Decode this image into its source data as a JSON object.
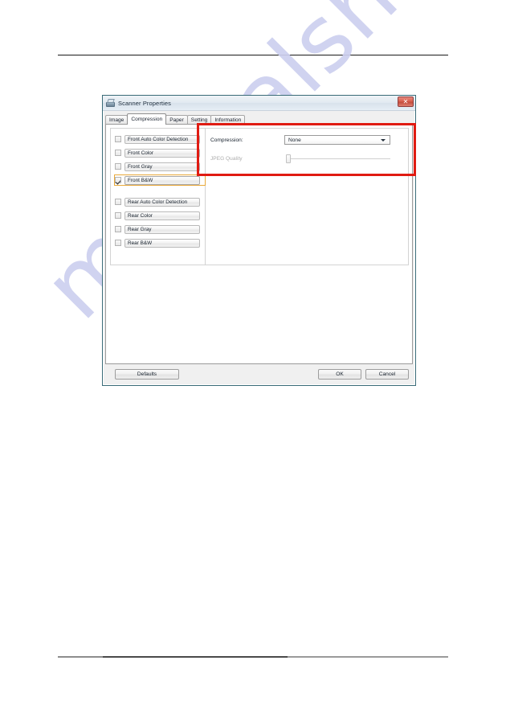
{
  "page": {
    "watermark_text": "manualshive.com",
    "watermark_color": "#cdd0ef"
  },
  "dialog": {
    "title": "Scanner Properties",
    "title_icon": "scanner-icon",
    "close_label": "✕",
    "accent_highlight_color": "#e01b12",
    "selection_highlight_color": "#e9a93a",
    "tabs": [
      {
        "label": "Image",
        "active": false
      },
      {
        "label": "Compression",
        "active": true
      },
      {
        "label": "Paper",
        "active": false
      },
      {
        "label": "Setting",
        "active": false
      },
      {
        "label": "Information",
        "active": false
      }
    ],
    "checkbox_list": {
      "front": [
        {
          "label": "Front Auto Color Detection",
          "checked": false,
          "highlighted": false
        },
        {
          "label": "Front Color",
          "checked": false,
          "highlighted": false
        },
        {
          "label": "Front Gray",
          "checked": false,
          "highlighted": false
        },
        {
          "label": "Front B&W",
          "checked": true,
          "highlighted": true
        }
      ],
      "rear": [
        {
          "label": "Rear Auto Color Detection",
          "checked": false,
          "highlighted": false
        },
        {
          "label": "Rear Color",
          "checked": false,
          "highlighted": false
        },
        {
          "label": "Rear Gray",
          "checked": false,
          "highlighted": false
        },
        {
          "label": "Rear B&W",
          "checked": false,
          "highlighted": false
        }
      ]
    },
    "settings": {
      "compression_label": "Compression:",
      "compression_value": "None",
      "compression_options": [
        "None"
      ],
      "jpeg_quality_label": "JPEG Quality",
      "jpeg_quality_disabled": true,
      "jpeg_quality_value": 0
    },
    "footer": {
      "defaults_label": "Defaults",
      "ok_label": "OK",
      "cancel_label": "Cancel"
    }
  }
}
